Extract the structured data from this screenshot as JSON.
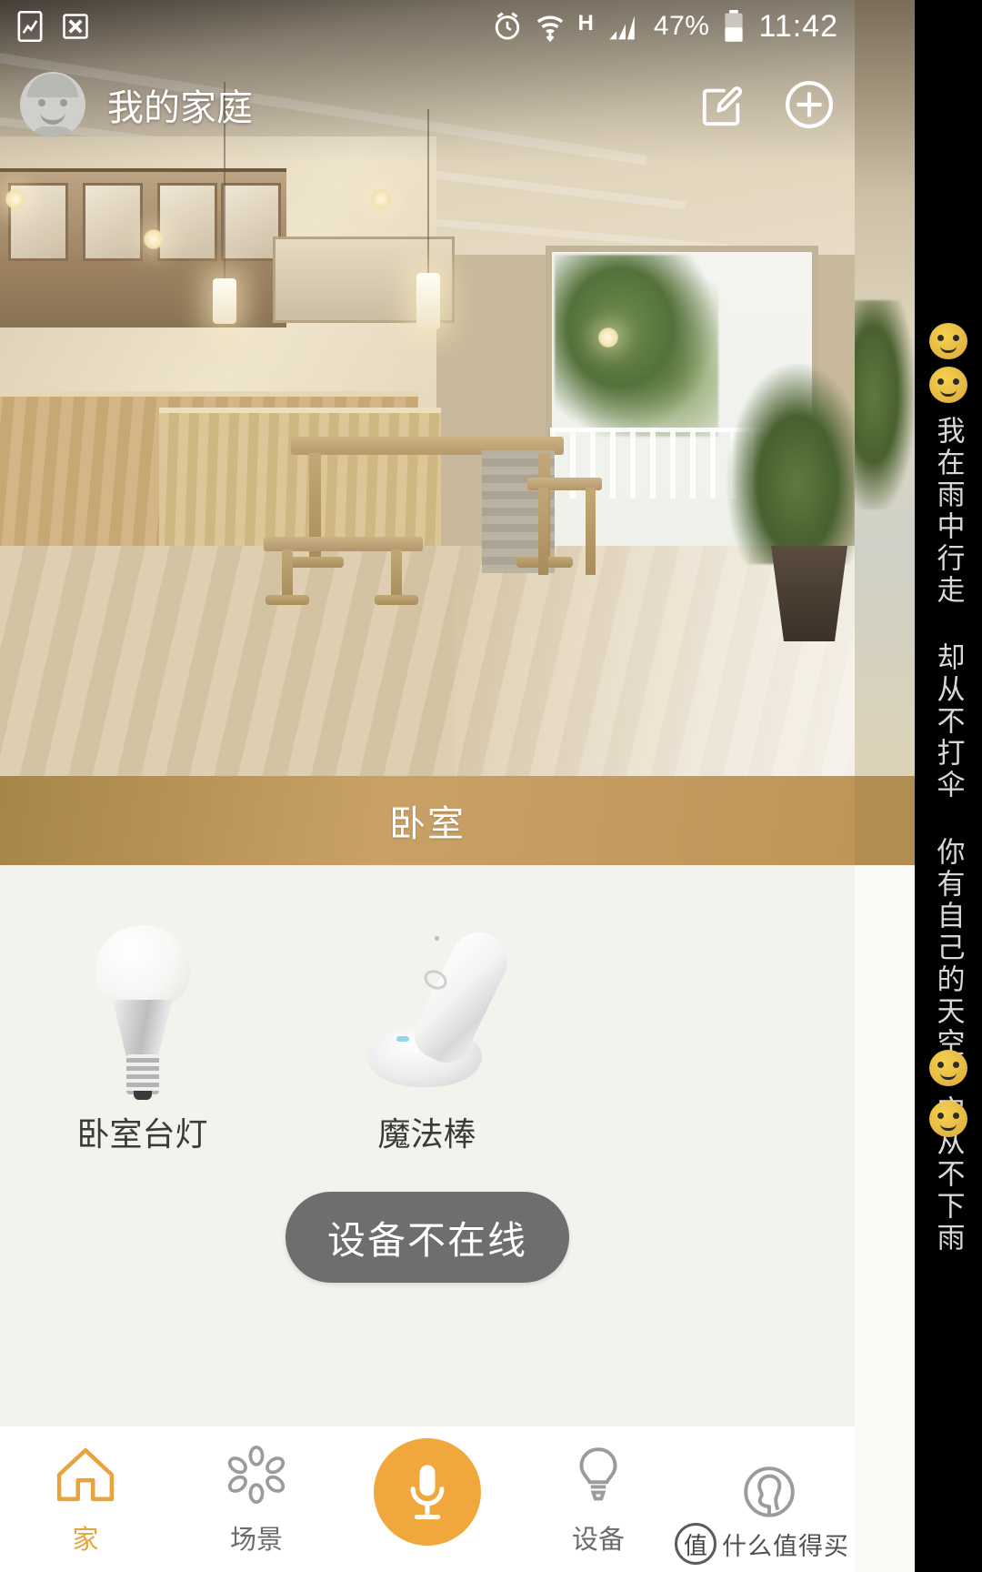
{
  "status_bar": {
    "icons_left": [
      "screenshot-icon",
      "close-x-icon"
    ],
    "icons_right": [
      "alarm-icon",
      "wifi-icon",
      "hspa-icon",
      "signal-icon"
    ],
    "network_type": "H",
    "battery_percent": "47%",
    "time": "11:42"
  },
  "app_bar": {
    "avatar": "user-avatar",
    "title": "我的家庭",
    "edit_icon": "edit-square-pencil-icon",
    "add_icon": "plus-circle-icon"
  },
  "hero": {
    "alt": "living-room-photo"
  },
  "room": {
    "name": "卧室"
  },
  "devices": [
    {
      "label": "卧室台灯",
      "icon": "light-bulb-icon"
    },
    {
      "label": "魔法棒",
      "icon": "magic-wand-icon"
    }
  ],
  "offline_button": {
    "label": "设备不在线"
  },
  "bottom_nav": {
    "items": [
      {
        "label": "家",
        "icon": "home-icon",
        "active": true
      },
      {
        "label": "场景",
        "icon": "scene-flower-icon",
        "active": false
      },
      {
        "label": "",
        "icon": "microphone-icon",
        "active": false
      },
      {
        "label": "设备",
        "icon": "bulb-outline-icon",
        "active": false
      },
      {
        "label": "",
        "icon": "profile-person-icon",
        "active": false
      }
    ]
  },
  "watermark": {
    "badge": "值",
    "text": "什么值得买"
  },
  "side_rail": {
    "text": "我在雨中行走 却从不打伞 你有自己的天空 它从不下雨",
    "emoji_top_count": 2,
    "emoji_bottom_count": 2
  },
  "colors": {
    "accent": "#F0A83C",
    "active_nav": "#E8A33D",
    "room_band": "#BF9557",
    "content_bg": "#F2F3EC",
    "offline_gray": "#6E6E6E"
  }
}
